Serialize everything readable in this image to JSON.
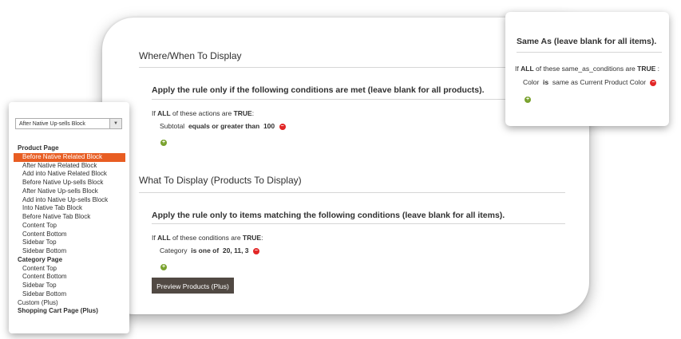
{
  "where_section": {
    "title": "Where/When To Display",
    "condition_title": "Apply the rule only if the following conditions are met (leave blank for all products).",
    "prefix": "If",
    "aggregator": "ALL",
    "middle": "of these actions are",
    "value": "TRUE",
    "suffix": ":",
    "rule": {
      "attribute": "Subtotal",
      "operator": "equals or greater than",
      "value": "100"
    }
  },
  "what_section": {
    "title": "What To Display (Products To Display)",
    "condition_title": "Apply the rule only to items matching the following conditions (leave blank for all items).",
    "prefix": "If",
    "aggregator": "ALL",
    "middle": "of these conditions are",
    "value": "TRUE",
    "suffix": ":",
    "rule": {
      "attribute": "Category",
      "operator": "is one of",
      "value": "20, 11, 3"
    },
    "preview_button": "Preview Products (Plus)"
  },
  "same_as_popup": {
    "title": "Same As (leave blank for all items).",
    "prefix": "If",
    "aggregator": "ALL",
    "middle": "of these same_as_conditions are",
    "value": "TRUE",
    "suffix": ":",
    "rule": {
      "attribute": "Color",
      "operator": "is",
      "value": "same as Current Product Color"
    }
  },
  "position_select": {
    "selected": "After Native Up-sells Block",
    "options": [
      {
        "label": "Product Page",
        "kind": "group"
      },
      {
        "label": "Before Native Related Block",
        "kind": "option",
        "selected": true
      },
      {
        "label": "After Native Related Block",
        "kind": "option"
      },
      {
        "label": "Add into Native Related Block",
        "kind": "option"
      },
      {
        "label": "Before Native Up-sells Block",
        "kind": "option"
      },
      {
        "label": "After Native Up-sells Block",
        "kind": "option"
      },
      {
        "label": "Add into Native Up-sells Block",
        "kind": "option"
      },
      {
        "label": "Into Native Tab Block",
        "kind": "option"
      },
      {
        "label": "Before Native Tab Block",
        "kind": "option"
      },
      {
        "label": "Content Top",
        "kind": "option"
      },
      {
        "label": "Content Bottom",
        "kind": "option"
      },
      {
        "label": "Sidebar Top",
        "kind": "option"
      },
      {
        "label": "Sidebar Bottom",
        "kind": "option"
      },
      {
        "label": "Category Page",
        "kind": "group"
      },
      {
        "label": "Content Top",
        "kind": "option"
      },
      {
        "label": "Content Bottom",
        "kind": "option"
      },
      {
        "label": "Sidebar Top",
        "kind": "option"
      },
      {
        "label": "Sidebar Bottom",
        "kind": "option"
      },
      {
        "label": "Custom (Plus)",
        "kind": "plain"
      },
      {
        "label": "Shopping Cart Page (Plus)",
        "kind": "group"
      }
    ]
  },
  "colors": {
    "selected_option": "#e85d22",
    "button_bg": "#514943",
    "add_icon": "#79a22e",
    "remove_icon": "#e22626"
  },
  "icons": {
    "add": "plus-circle-icon",
    "remove": "minus-circle-icon",
    "dropdown": "chevron-down-icon"
  }
}
